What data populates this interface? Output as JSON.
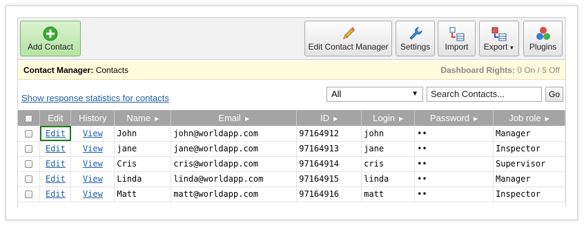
{
  "toolbar": {
    "add_contact": "Add Contact",
    "edit_manager": "Edit Contact Manager",
    "settings": "Settings",
    "import": "Import",
    "export": "Export",
    "plugins": "Plugins"
  },
  "infobar": {
    "left_bold": "Contact Manager:",
    "left_rest": "Contacts",
    "right_bold": "Dashboard Rights:",
    "right_rest": "0 On / 5 Off"
  },
  "filters": {
    "stats_link": "Show response statistics for contacts",
    "select_value": "All",
    "search_placeholder": "Search Contacts...",
    "go": "Go"
  },
  "table": {
    "headers": [
      "Edit",
      "History",
      "Name",
      "Email",
      "ID",
      "Login",
      "Password",
      "Job role"
    ],
    "rows": [
      {
        "edit": "Edit",
        "history": "View",
        "name": "John",
        "email": "john@worldapp.com",
        "id": "97164912",
        "login": "john",
        "password": "••",
        "role": "Manager"
      },
      {
        "edit": "Edit",
        "history": "View",
        "name": "jane",
        "email": "jane@worldapp.com",
        "id": "97164913",
        "login": "jane",
        "password": "••",
        "role": "Inspector"
      },
      {
        "edit": "Edit",
        "history": "View",
        "name": "Cris",
        "email": "cris@worldapp.com",
        "id": "97164914",
        "login": "cris",
        "password": "••",
        "role": "Supervisor"
      },
      {
        "edit": "Edit",
        "history": "View",
        "name": "Linda",
        "email": "linda@worldapp.com",
        "id": "97164915",
        "login": "linda",
        "password": "••",
        "role": "Manager"
      },
      {
        "edit": "Edit",
        "history": "View",
        "name": "Matt",
        "email": "matt@worldapp.com",
        "id": "97164916",
        "login": "matt",
        "password": "••",
        "role": "Inspector"
      }
    ]
  },
  "colors": {
    "link": "#1f5fa8",
    "header_bg": "#a4a4a4",
    "infobar_bg": "#fffbdc",
    "add_button": "#b7e3a5",
    "highlight": "#1a7d1a"
  }
}
